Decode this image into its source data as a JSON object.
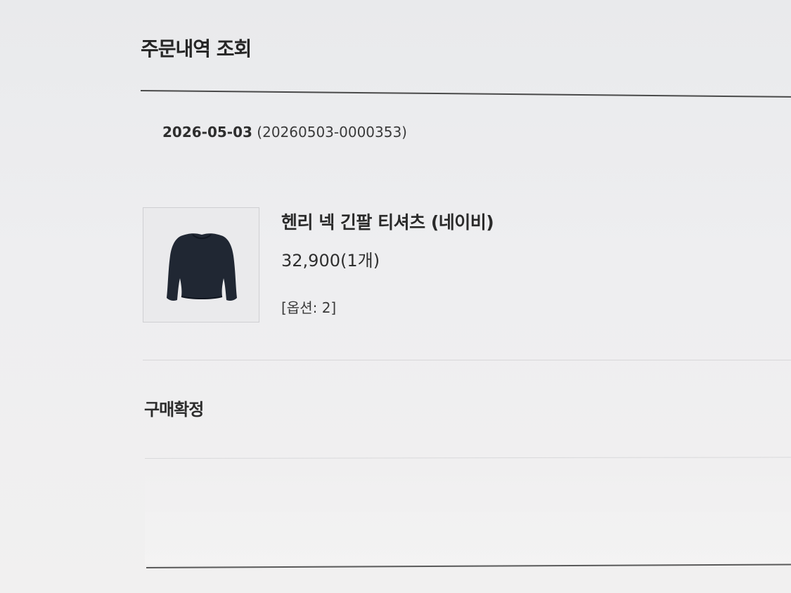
{
  "page": {
    "title": "주문내역 조회"
  },
  "order": {
    "date": "2026-05-03",
    "number": "(20260503-0000353)"
  },
  "product": {
    "name": "헨리 넥 긴팔 티셔츠 (네이비)",
    "price_quantity": "32,900(1개)",
    "option": "[옵션: 2]",
    "image_icon": "navy-long-sleeve-shirt"
  },
  "section": {
    "purchase_confirmation_title": "구매확정"
  },
  "colors": {
    "shirt": "#202733",
    "text": "#2b2b2b",
    "divider": "#4a4a4a"
  }
}
